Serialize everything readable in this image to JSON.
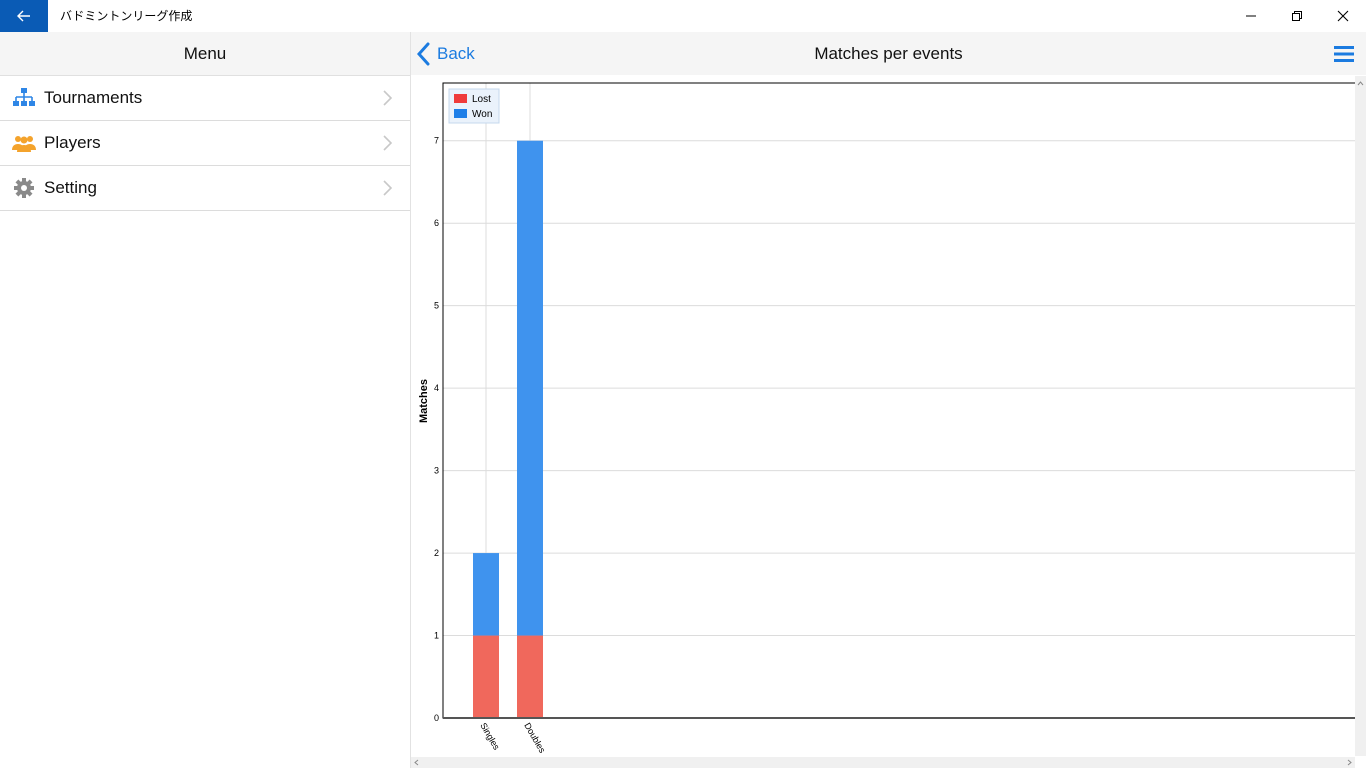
{
  "titlebar": {
    "title": "バドミントンリーグ作成"
  },
  "left": {
    "header": "Menu",
    "items": [
      {
        "label": "Tournaments",
        "icon": "sitemap-icon"
      },
      {
        "label": "Players",
        "icon": "users-icon"
      },
      {
        "label": "Setting",
        "icon": "gear-icon"
      }
    ]
  },
  "right": {
    "back_label": "Back",
    "title": "Matches per events"
  },
  "colors": {
    "accent": "#1b7be0",
    "lost": "#f0685c",
    "won": "#3f93ee",
    "titlebar_back": "#0a5bb5"
  },
  "chart_data": {
    "type": "bar",
    "stacked": true,
    "categories": [
      "Singles",
      "Doubles"
    ],
    "series": [
      {
        "name": "Lost",
        "values": [
          1,
          1
        ]
      },
      {
        "name": "Won",
        "values": [
          1,
          6
        ]
      }
    ],
    "ylabel": "Matches",
    "ylim": [
      0,
      7.7
    ],
    "yticks": [
      "0",
      "1",
      "2",
      "3",
      "4",
      "5",
      "6",
      "7"
    ],
    "grid": true,
    "legend": "top-left"
  }
}
